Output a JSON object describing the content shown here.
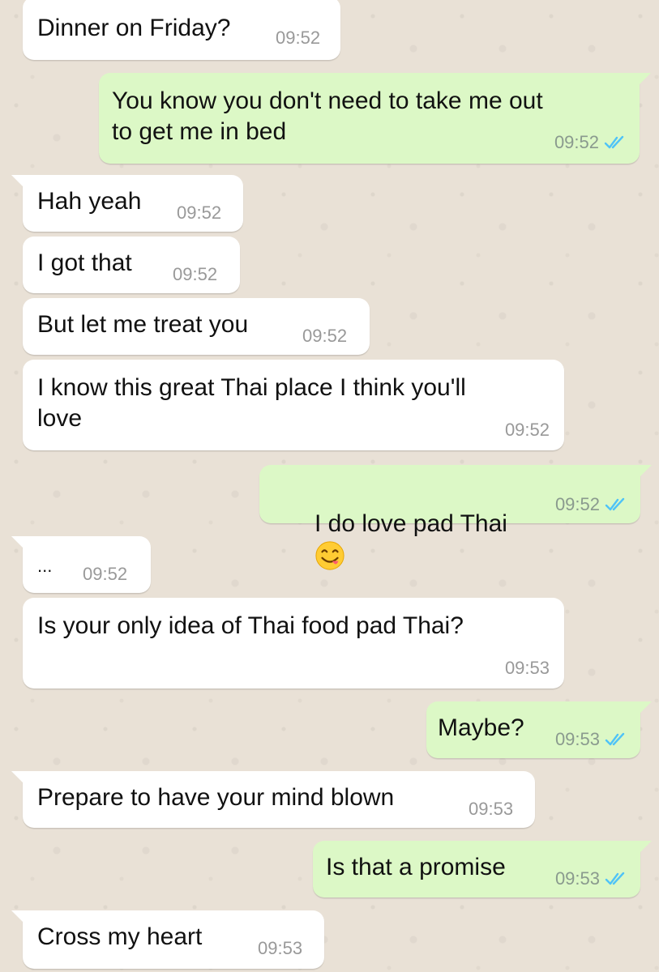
{
  "colors": {
    "incoming_bubble": "#ffffff",
    "outgoing_bubble": "#dcf8c6",
    "read_ticks": "#4fc3f7",
    "wallpaper": "#e9e1d6"
  },
  "messages": [
    {
      "direction": "in",
      "text": "Dinner on Friday?",
      "time": "09:52"
    },
    {
      "direction": "out",
      "text": "You know you don't need to take me out\nto get me in bed",
      "time": "09:52",
      "status": "read"
    },
    {
      "direction": "in",
      "text": "Hah yeah",
      "time": "09:52"
    },
    {
      "direction": "in",
      "text": "I got that",
      "time": "09:52"
    },
    {
      "direction": "in",
      "text": "But let me treat you",
      "time": "09:52"
    },
    {
      "direction": "in",
      "text": "I know this great Thai place I think you'll\nlove",
      "time": "09:52"
    },
    {
      "direction": "out",
      "text": "I do love pad Thai",
      "emoji": "yum-face-emoji",
      "time": "09:52",
      "status": "read"
    },
    {
      "direction": "in",
      "text": "...",
      "time": "09:52"
    },
    {
      "direction": "in",
      "text": "Is your only idea of Thai food pad Thai?",
      "time": "09:53"
    },
    {
      "direction": "out",
      "text": "Maybe?",
      "time": "09:53",
      "status": "read"
    },
    {
      "direction": "in",
      "text": "Prepare to have your mind blown",
      "time": "09:53"
    },
    {
      "direction": "out",
      "text": "Is that a promise",
      "time": "09:53",
      "status": "read"
    },
    {
      "direction": "in",
      "text": "Cross my heart",
      "time": "09:53"
    }
  ]
}
